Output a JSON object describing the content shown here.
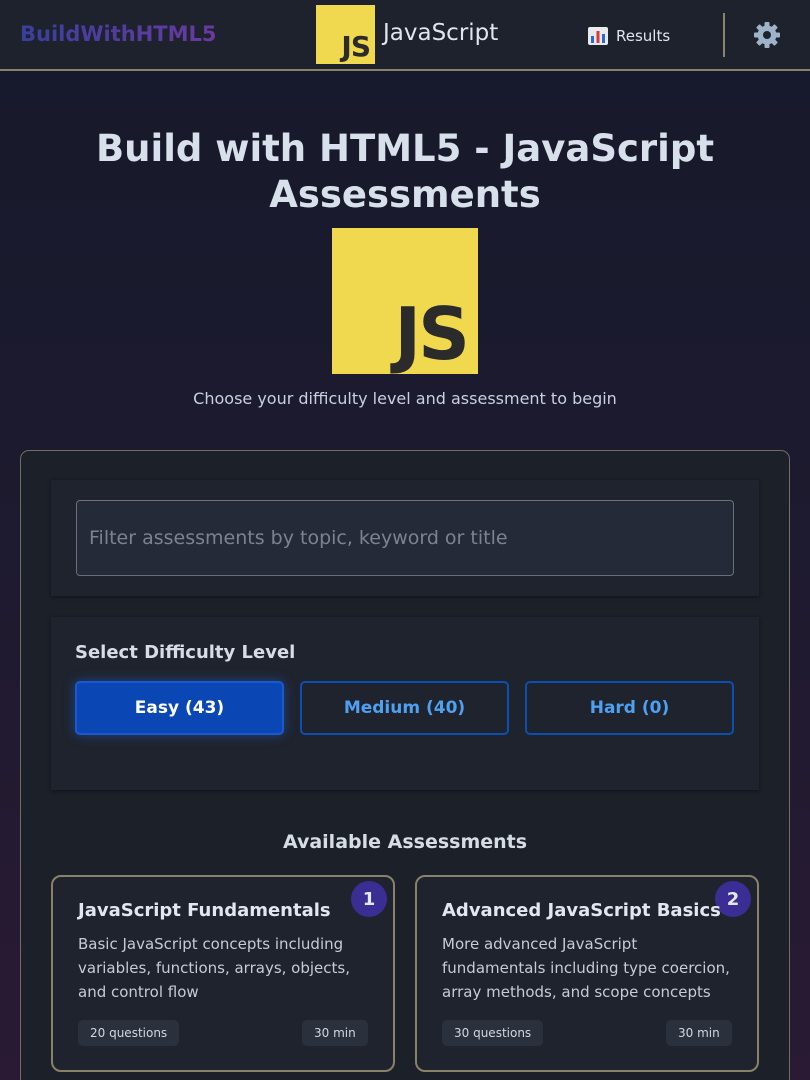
{
  "header": {
    "brand": "BuildWithHTML5",
    "logo_text": "JS",
    "language": "JavaScript",
    "results_label": "Results",
    "results_icon": "bar-chart-icon",
    "settings_icon": "gear-icon"
  },
  "hero": {
    "title": "Build with HTML5 - JavaScript Assessments",
    "logo_text": "JS",
    "subtitle": "Choose your difficulty level and assessment to begin"
  },
  "filter": {
    "placeholder": "Filter assessments by topic, keyword or title",
    "value": ""
  },
  "difficulty": {
    "label": "Select Difficulty Level",
    "options": [
      {
        "label": "Easy (43)",
        "active": true
      },
      {
        "label": "Medium (40)",
        "active": false
      },
      {
        "label": "Hard (0)",
        "active": false
      }
    ]
  },
  "assessments": {
    "title": "Available Assessments",
    "items": [
      {
        "number": "1",
        "title": "JavaScript Fundamentals",
        "description": "Basic JavaScript concepts including variables, functions, arrays, objects, and control flow",
        "questions": "20 questions",
        "duration": "30 min"
      },
      {
        "number": "2",
        "title": "Advanced JavaScript Basics",
        "description": "More advanced JavaScript fundamentals including type coercion, array methods, and scope concepts",
        "questions": "30 questions",
        "duration": "30 min"
      }
    ]
  },
  "colors": {
    "accent_blue": "#0a46b4",
    "logo_yellow": "#f0d94e",
    "border_gold": "#8a8268",
    "badge_purple": "#3a2e95"
  }
}
